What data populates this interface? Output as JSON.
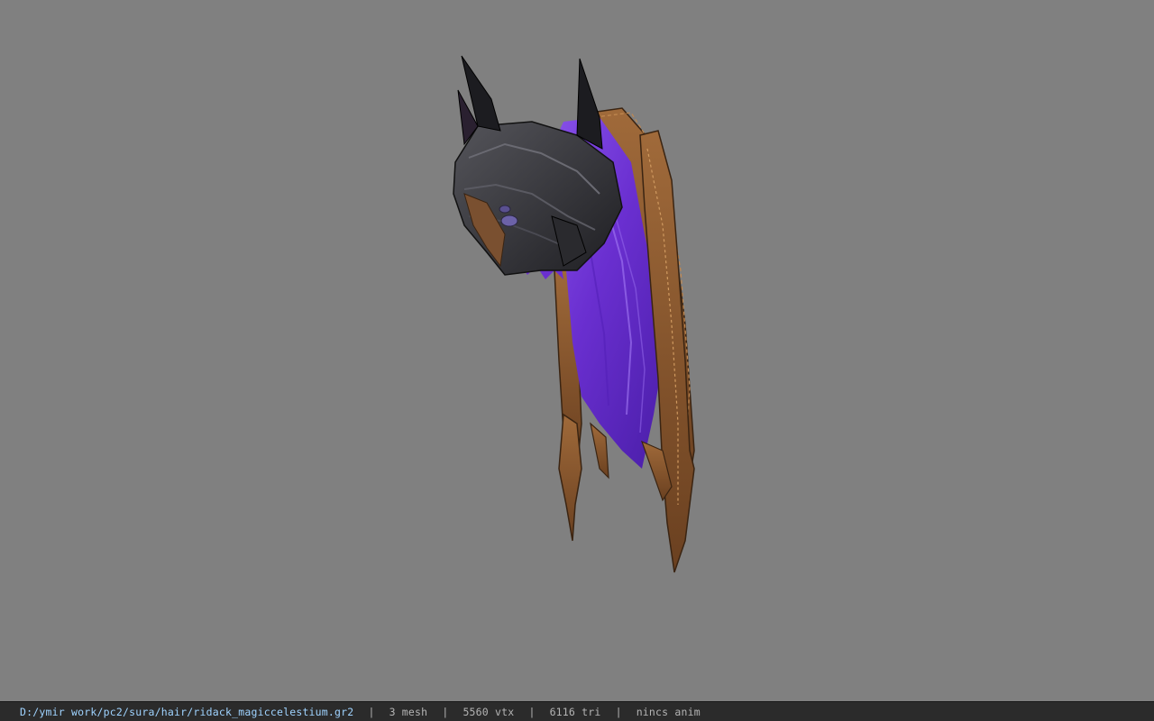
{
  "viewport": {
    "background_color": "#808080",
    "model": {
      "colors": {
        "hair": "#6a2fd0",
        "hair_highlight": "#8f5af0",
        "helmet": "#2e2e32",
        "helmet_highlight": "#5a5a60",
        "chain": "#8a5a30",
        "chain_dark": "#4a2e18"
      }
    }
  },
  "statusbar": {
    "file_path": "D:/ymir work/pc2/sura/hair/ridack_magiccelestium.gr2",
    "separator": "|",
    "mesh_count": "3 mesh",
    "vertex_count": "5560 vtx",
    "triangle_count": "6116 tri",
    "animation": "nincs anim",
    "path_color": "#9fd3ff",
    "text_color": "#b4b4b4",
    "background_color": "#2b2b2b"
  }
}
